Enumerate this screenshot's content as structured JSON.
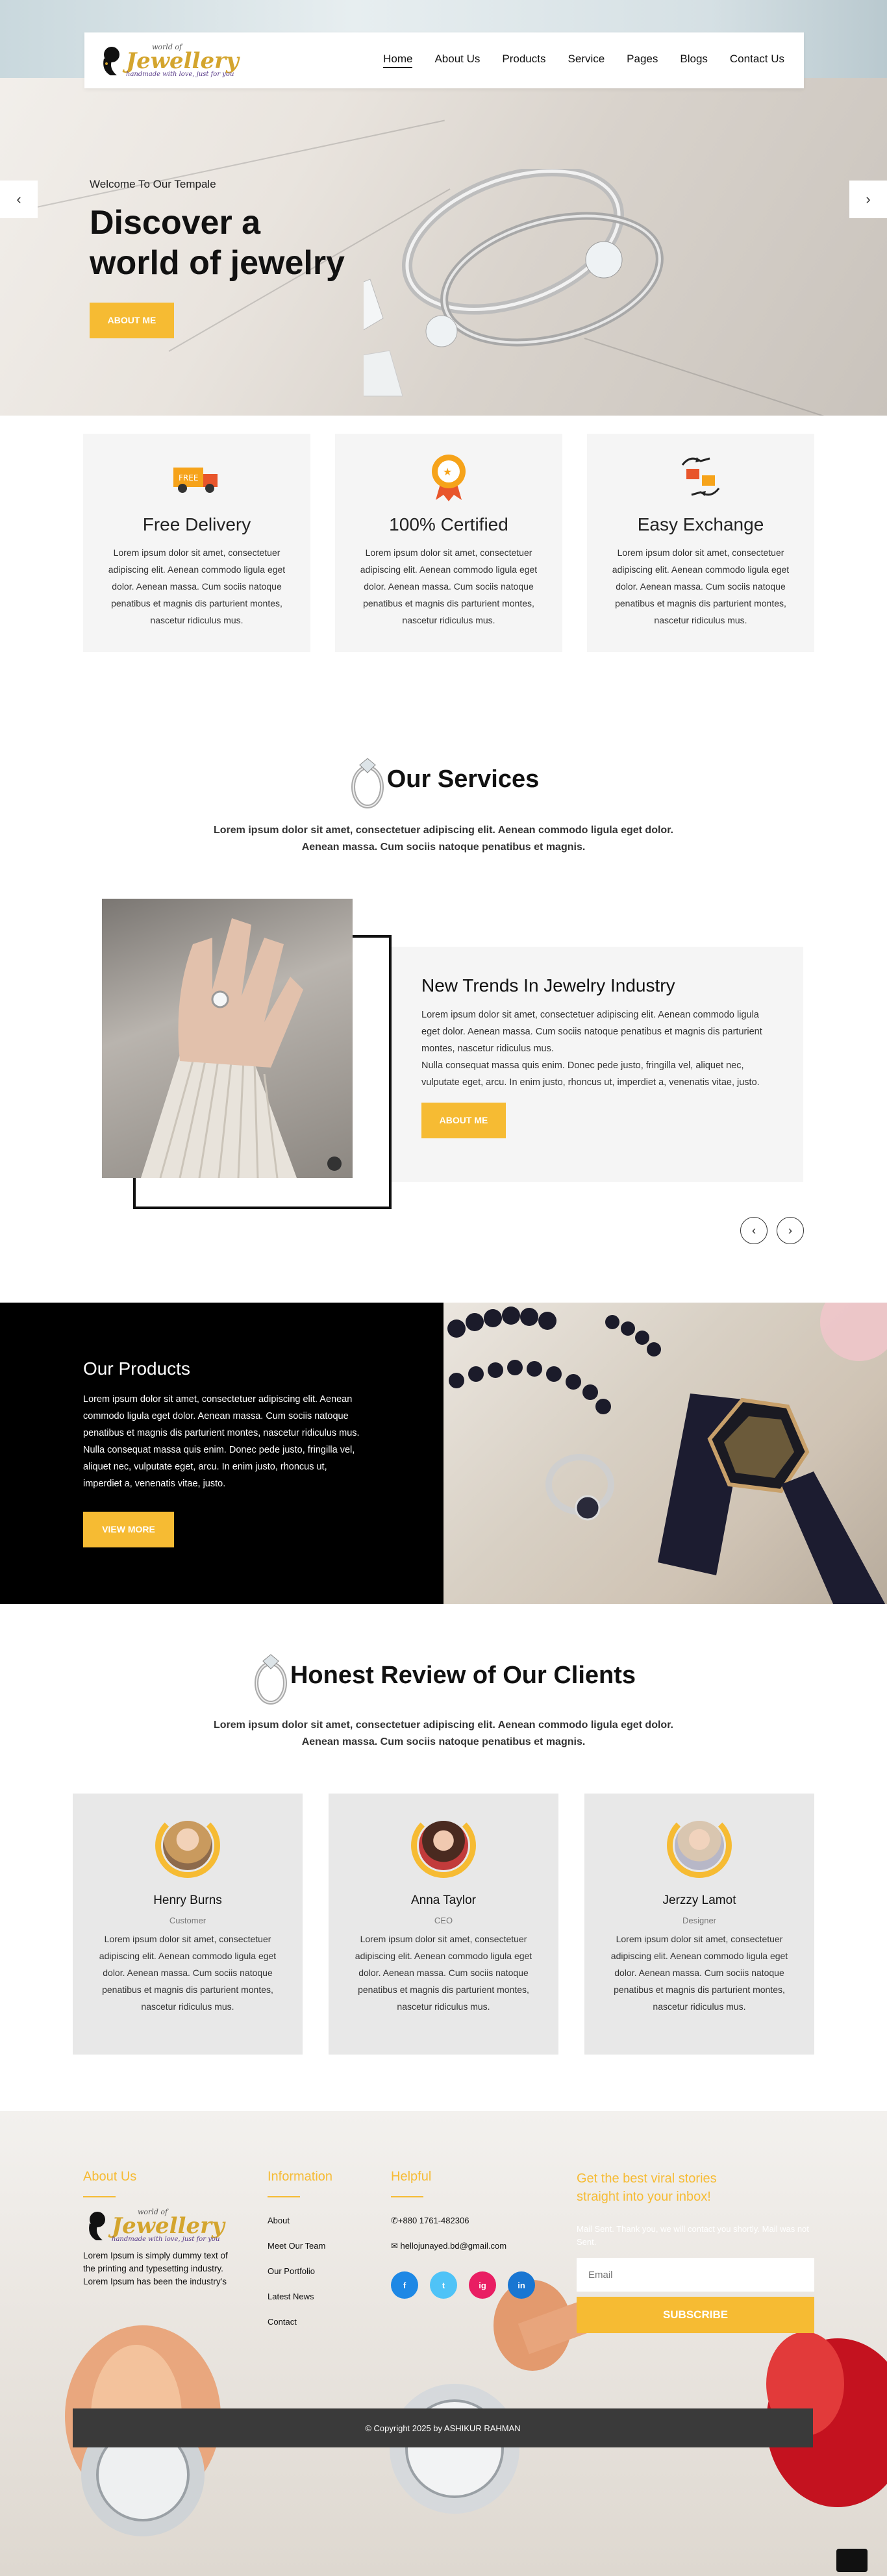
{
  "nav": {
    "logo_line1": "world of",
    "logo_line2": "Jewellery",
    "logo_line3": "handmade with love, just for you",
    "items": [
      "Home",
      "About Us",
      "Products",
      "Service",
      "Pages",
      "Blogs",
      "Contact Us"
    ],
    "active": "Home"
  },
  "hero": {
    "welcome": "Welcome To Our Tempale",
    "title_line1": "Discover a",
    "title_line2": "world of jewelry",
    "button": "ABOUT ME"
  },
  "features": [
    {
      "icon": "delivery-truck-icon",
      "title": "Free Delivery",
      "text": "Lorem ipsum dolor sit amet, consectetuer adipiscing elit. Aenean commodo ligula eget dolor. Aenean massa. Cum sociis natoque penatibus et magnis dis parturient montes, nascetur ridiculus mus."
    },
    {
      "icon": "certified-badge-icon",
      "title": "100% Certified",
      "text": "Lorem ipsum dolor sit amet, consectetuer adipiscing elit. Aenean commodo ligula eget dolor. Aenean massa. Cum sociis natoque penatibus et magnis dis parturient montes, nascetur ridiculus mus."
    },
    {
      "icon": "exchange-hands-icon",
      "title": "Easy Exchange",
      "text": "Lorem ipsum dolor sit amet, consectetuer adipiscing elit. Aenean commodo ligula eget dolor. Aenean massa. Cum sociis natoque penatibus et magnis dis parturient montes, nascetur ridiculus mus."
    }
  ],
  "services": {
    "title": "Our Services",
    "sub_line1": "Lorem ipsum dolor sit amet, consectetuer adipiscing elit. Aenean commodo ligula eget dolor.",
    "sub_line2": "Aenean massa. Cum sociis natoque penatibus et magnis.",
    "card_title": "New Trends In Jewelry Industry",
    "card_p1": "Lorem ipsum dolor sit amet, consectetuer adipiscing elit. Aenean commodo ligula eget dolor. Aenean massa. Cum sociis natoque penatibus et magnis dis parturient montes, nascetur ridiculus mus.",
    "card_p2": "Nulla consequat massa quis enim. Donec pede justo, fringilla vel, aliquet nec, vulputate eget, arcu. In enim justo, rhoncus ut, imperdiet a, venenatis vitae, justo.",
    "button": "ABOUT ME"
  },
  "products": {
    "title": "Our Products",
    "text": "Lorem ipsum dolor sit amet, consectetuer adipiscing elit. Aenean commodo ligula eget dolor. Aenean massa. Cum sociis natoque penatibus et magnis dis parturient montes, nascetur ridiculus mus. Nulla consequat massa quis enim. Donec pede justo, fringilla vel, aliquet nec, vulputate eget, arcu. In enim justo, rhoncus ut, imperdiet a, venenatis vitae, justo.",
    "button": "VIEW MORE"
  },
  "reviews": {
    "title": "Honest Review of Our Clients",
    "sub_line1": "Lorem ipsum dolor sit amet, consectetuer adipiscing elit. Aenean commodo ligula eget dolor.",
    "sub_line2": "Aenean massa. Cum sociis natoque penatibus et magnis.",
    "items": [
      {
        "name": "Henry Burns",
        "role": "Customer",
        "text": "Lorem ipsum dolor sit amet, consectetuer adipiscing elit. Aenean commodo ligula eget dolor. Aenean massa. Cum sociis natoque penatibus et magnis dis parturient montes, nascetur ridiculus mus."
      },
      {
        "name": "Anna Taylor",
        "role": "CEO",
        "text": "Lorem ipsum dolor sit amet, consectetuer adipiscing elit. Aenean commodo ligula eget dolor. Aenean massa. Cum sociis natoque penatibus et magnis dis parturient montes, nascetur ridiculus mus."
      },
      {
        "name": "Jerzzy Lamot",
        "role": "Designer",
        "text": "Lorem ipsum dolor sit amet, consectetuer adipiscing elit. Aenean commodo ligula eget dolor. Aenean massa. Cum sociis natoque penatibus et magnis dis parturient montes, nascetur ridiculus mus."
      }
    ]
  },
  "footer": {
    "about_title": "About Us",
    "about_text": "Lorem Ipsum is simply dummy text of the printing and typesetting industry. Lorem Ipsum has been the industry's",
    "info_title": "Information",
    "info_items": [
      "About",
      "Meet Our Team",
      "Our Portfolio",
      "Latest News",
      "Contact"
    ],
    "helpful_title": "Helpful",
    "phone": "+880 1761-482306",
    "email": "hellojunayed.bd@gmail.com",
    "social": [
      "f",
      "t",
      "ig",
      "in"
    ],
    "news_title": "Get the best viral stories straight into your inbox!",
    "news_note": "Mail Sent. Thank you, we will contact you shortly. Mail was not Sent.",
    "email_placeholder": "Email",
    "subscribe": "SUBSCRIBE",
    "copyright": "© Copyright 2025 by ASHIKUR RAHMAN"
  },
  "colors": {
    "accent": "#f6bb33",
    "dark": "#000000",
    "card": "#f5f5f5"
  }
}
